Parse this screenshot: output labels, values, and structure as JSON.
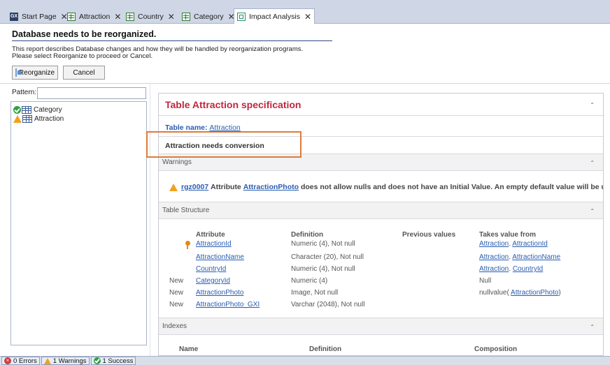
{
  "tabs": [
    {
      "label": "Start Page",
      "icon": "gx-logo-icon"
    },
    {
      "label": "Attraction",
      "icon": "transaction-grid-icon"
    },
    {
      "label": "Country",
      "icon": "transaction-grid-icon"
    },
    {
      "label": "Category",
      "icon": "transaction-grid-icon"
    },
    {
      "label": "Impact Analysis",
      "icon": "impact-analysis-icon",
      "active": true
    }
  ],
  "tab_close": "✕",
  "header": {
    "title": "Database needs to be reorganized.",
    "desc_line1": "This report describes Database changes and how they will be handled by reorganization programs.",
    "desc_line2": "Please select Reorganize to proceed or Cancel."
  },
  "toolbar": {
    "reorganize_label": "Reorganize",
    "cancel_label": "Cancel"
  },
  "left_panel": {
    "pattern_label": "Pattern:",
    "pattern_value": "",
    "items": [
      {
        "label": "Category",
        "status": "success"
      },
      {
        "label": "Attraction",
        "status": "warning"
      }
    ]
  },
  "spec": {
    "title": "Table Attraction specification",
    "collapse_glyph": "⌃",
    "table_name_label": "Table name:",
    "table_name_value": "Attraction",
    "conversion_note": "Attraction needs conversion",
    "warnings_label": "Warnings",
    "warning": {
      "code": "rgz0007",
      "text_before": "Attribute",
      "attribute": "AttractionPhoto",
      "text_after": "does not allow nulls and does not have an Initial Value. An empty default value will be used."
    },
    "structure_label": "Table Structure",
    "structure_headers": [
      "Attribute",
      "Definition",
      "Previous values",
      "Takes value from"
    ],
    "structure_rows": [
      {
        "prefix": "",
        "key": true,
        "attribute": "AttractionId",
        "definition": "Numeric (4), Not null",
        "takes_tbl": "Attraction",
        "takes_attr": "AttractionId",
        "takes_text": ""
      },
      {
        "prefix": "",
        "key": false,
        "attribute": "AttractionName",
        "definition": "Character (20), Not null",
        "takes_tbl": "Attraction",
        "takes_attr": "AttractionName",
        "takes_text": ""
      },
      {
        "prefix": "",
        "key": false,
        "attribute": "CountryId",
        "definition": "Numeric (4), Not null",
        "takes_tbl": "Attraction",
        "takes_attr": "CountryId",
        "takes_text": ""
      },
      {
        "prefix": "New",
        "key": false,
        "attribute": "CategoryId",
        "definition": "Numeric (4)",
        "takes_tbl": "",
        "takes_attr": "",
        "takes_text": "Null"
      },
      {
        "prefix": "New",
        "key": false,
        "attribute": "AttractionPhoto",
        "definition": "Image, Not null",
        "takes_tbl": "",
        "takes_attr": "AttractionPhoto",
        "takes_text": "nullvalue("
      },
      {
        "prefix": "New",
        "key": false,
        "attribute": "AttractionPhoto_GXI",
        "definition": "Varchar (2048), Not null",
        "takes_tbl": "",
        "takes_attr": "",
        "takes_text": ""
      }
    ],
    "indexes_label": "Indexes",
    "index_headers": [
      "Name",
      "Definition",
      "Composition"
    ]
  },
  "status_bar": {
    "errors": "0 Errors",
    "warnings": "1 Warnings",
    "success": "1 Success"
  },
  "colors": {
    "accent_title": "#c0273f",
    "link": "#2a5db0",
    "highlight": "#e07b39"
  }
}
